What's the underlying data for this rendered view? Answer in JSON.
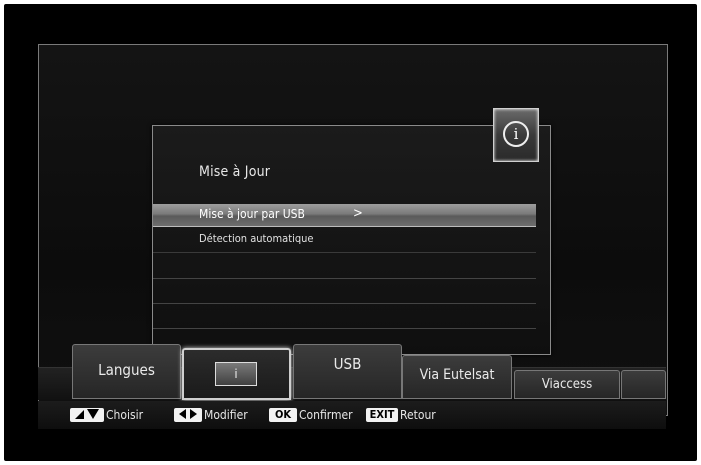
{
  "dialog": {
    "title": "Mise à Jour",
    "items": [
      {
        "label": "Mise à jour par USB",
        "selected": true,
        "has_submenu": true,
        "chevron": ">"
      },
      {
        "label": "Détection automatique",
        "selected": false
      }
    ]
  },
  "info_badge": {
    "glyph": "i"
  },
  "tabs": [
    {
      "label": "Langues"
    },
    {
      "label": "",
      "icon": "info-screen-icon",
      "glyph": "i",
      "active": true
    },
    {
      "label": "USB"
    },
    {
      "label": "Via Eutelsat"
    },
    {
      "label": "Viaccess"
    },
    {
      "label": ""
    }
  ],
  "help": [
    {
      "key_icon": "up-down-arrows-icon",
      "label": "Choisir"
    },
    {
      "key_icon": "left-right-arrows-icon",
      "label": "Modifier"
    },
    {
      "key_text": "OK",
      "label": "Confirmer"
    },
    {
      "key_text": "EXIT",
      "label": "Retour"
    }
  ],
  "colors": {
    "background": "#000000",
    "selection": "#8a8a8a",
    "text": "#e8e8e8"
  }
}
